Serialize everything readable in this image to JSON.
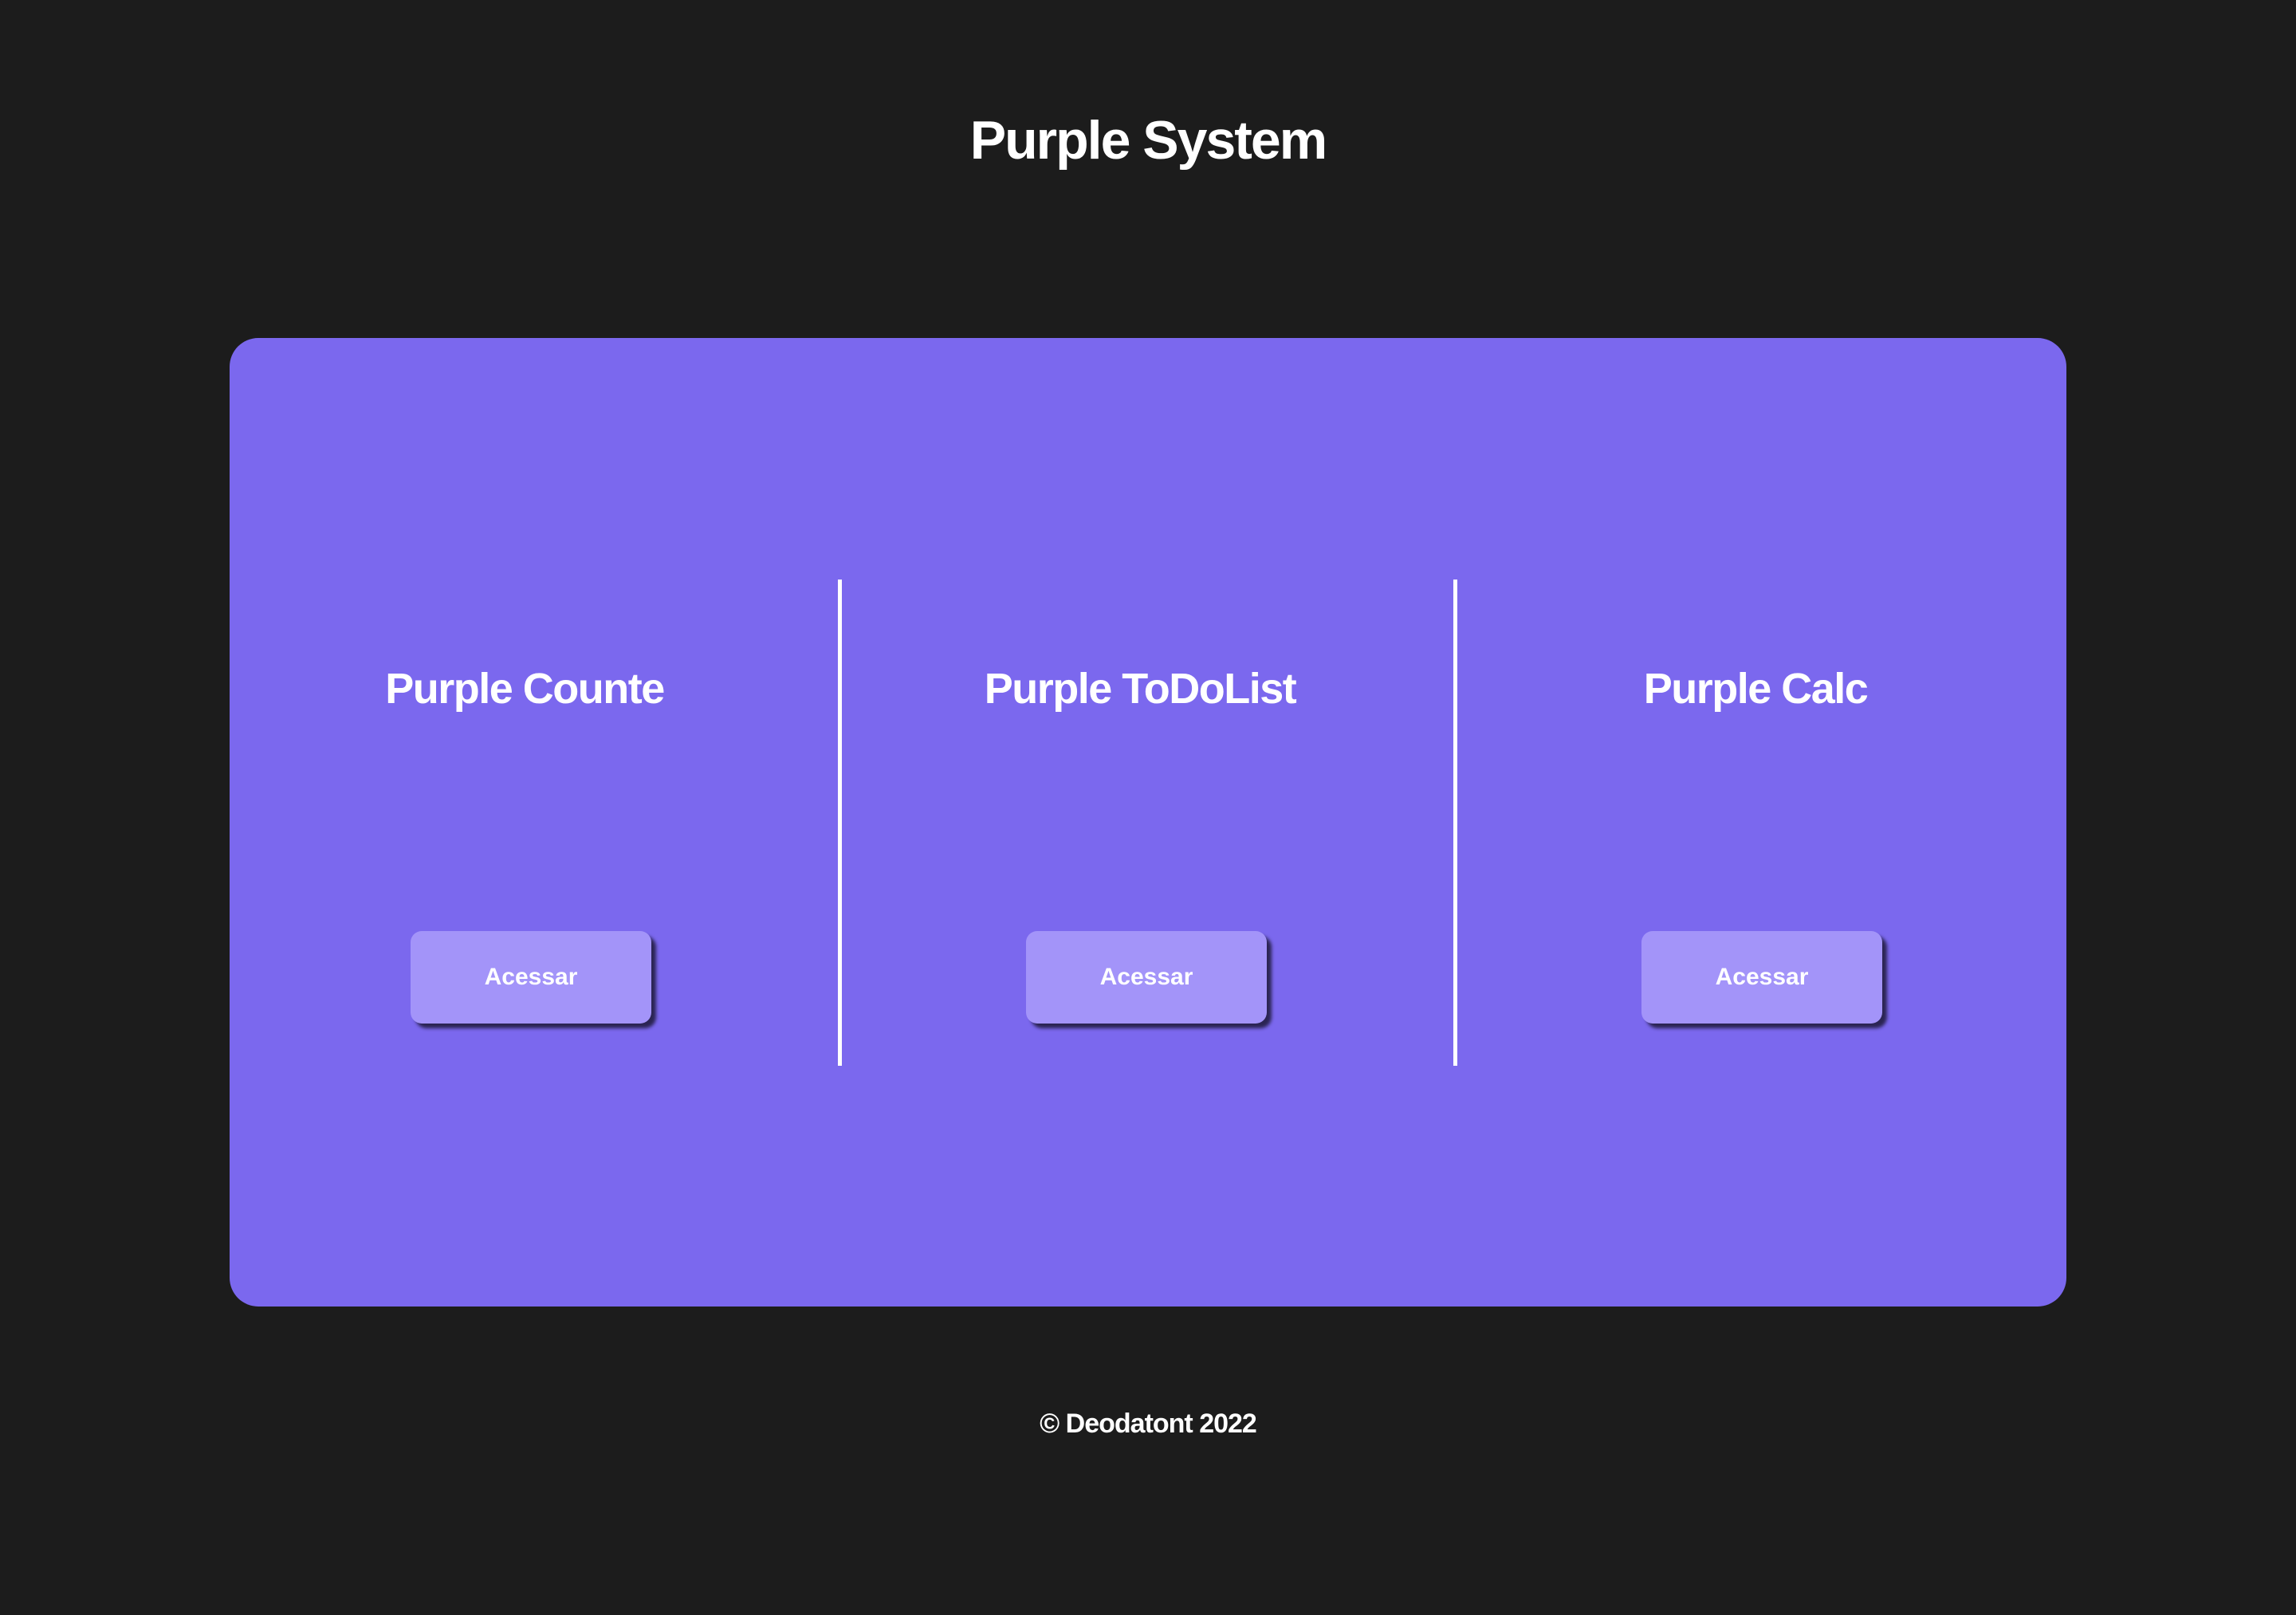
{
  "header": {
    "title": "Purple System"
  },
  "apps": [
    {
      "title": "Purple Counte",
      "button_label": "Acessar"
    },
    {
      "title": "Purple ToDoList",
      "button_label": "Acessar"
    },
    {
      "title": "Purple Calc",
      "button_label": "Acessar"
    }
  ],
  "footer": {
    "text": "© Deodatont 2022"
  },
  "colors": {
    "background": "#1c1c1c",
    "panel": "#7b68ee",
    "button": "#a394f9",
    "text": "#ffffff"
  }
}
